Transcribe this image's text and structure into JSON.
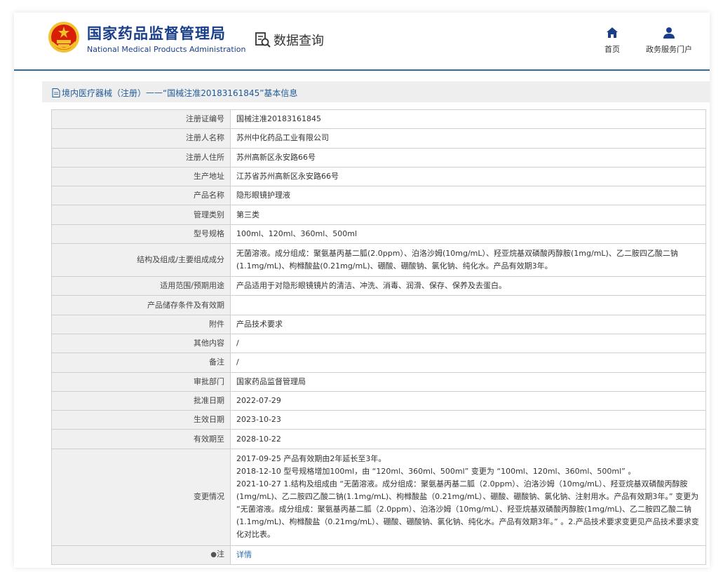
{
  "header": {
    "org_name_cn": "国家药品监督管理局",
    "org_name_en": "National Medical Products Administration",
    "query_title": "数据查询",
    "nav": [
      {
        "label": "首页",
        "icon": "home-icon"
      },
      {
        "label": "政务服务门户",
        "icon": "user-icon"
      }
    ]
  },
  "panel": {
    "title_prefix": "境内医疗器械（注册）",
    "title_sep": "——",
    "title_main": "“国械注准20183161845”基本信息"
  },
  "rows": [
    {
      "label": "注册证编号",
      "value": "国械注准20183161845"
    },
    {
      "label": "注册人名称",
      "value": "苏州中化药品工业有限公司"
    },
    {
      "label": "注册人住所",
      "value": "苏州高新区永安路66号"
    },
    {
      "label": "生产地址",
      "value": "江苏省苏州高新区永安路66号"
    },
    {
      "label": "产品名称",
      "value": "隐形眼镜护理液"
    },
    {
      "label": "管理类别",
      "value": "第三类"
    },
    {
      "label": "型号规格",
      "value": "100ml、120ml、360ml、500ml"
    },
    {
      "label": "结构及组成/主要组成成分",
      "value": "无菌溶液。成分组成：聚氨基丙基二胍(2.0ppm）、泊洛沙姆(10mg/mL）、羟亚烷基双磷酸丙醇胺(1mg/mL)、乙二胺四乙酸二钠(1.1mg/mL)、枸橼酸盐(0.21mg/mL)、硼酸、硼酸钠、氯化钠、纯化水。产品有效期3年。"
    },
    {
      "label": "适用范围/预期用途",
      "value": "产品适用于对隐形眼镜镜片的清洁、冲洗、消毒、润滑、保存、保养及去蛋白。"
    },
    {
      "label": "产品储存条件及有效期",
      "value": ""
    },
    {
      "label": "附件",
      "value": "产品技术要求"
    },
    {
      "label": "其他内容",
      "value": "/"
    },
    {
      "label": "备注",
      "value": "/"
    },
    {
      "label": "审批部门",
      "value": "国家药品监督管理局"
    },
    {
      "label": "批准日期",
      "value": "2022-07-29"
    },
    {
      "label": "生效日期",
      "value": "2023-10-23"
    },
    {
      "label": "有效期至",
      "value": "2028-10-22"
    }
  ],
  "changes": {
    "label": "变更情况",
    "lines": [
      "2017-09-25 产品有效期由2年延长至3年。",
      "2018-12-10 型号规格增加100ml，由 “120ml、360ml、500ml” 变更为 “100ml、120ml、360ml、500ml” 。",
      "2021-10-27 1.结构及组成由 “无菌溶液。成分组成：聚氨基丙基二胍（2.0ppm）、泊洛沙姆（10mg/mL）、羟亚烷基双磷酸丙醇胺(1mg/mL)、乙二胺四乙酸二钠(1.1mg/mL)、枸橼酸盐（0.21mg/mL）、硼酸、硼酸钠、氯化钠、注射用水。产品有效期3年。” 变更为 “无菌溶液。成分组成：聚氨基丙基二胍（2.0ppm）、泊洛沙姆（10mg/mL）、羟亚烷基双磷酸丙醇胺(1mg/mL)、乙二胺四乙酸二钠(1.1mg/mL)、枸橼酸盐（0.21mg/mL）、硼酸、硼酸钠、氯化钠、纯化水。产品有效期3年。” 。2.产品技术要求变更见产品技术要求变化对比表。"
    ]
  },
  "note": {
    "label": "注",
    "link": "详情",
    "icon": "pin-icon"
  },
  "colors": {
    "brand_blue": "#1a3f8a",
    "accent_line": "#2f6ca3",
    "link": "#2a6db5",
    "emblem_red": "#d81e06",
    "emblem_gold": "#f2c12e"
  }
}
